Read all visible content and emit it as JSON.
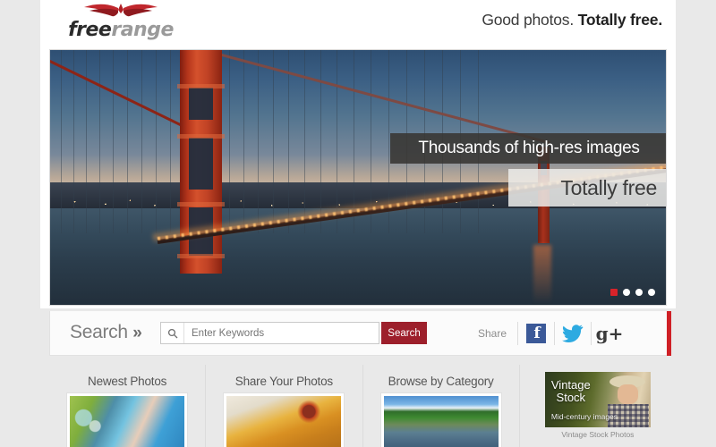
{
  "header": {
    "logo": {
      "part1": "free",
      "part2": "range",
      "icon": "wings-logo-icon"
    },
    "tagline_regular": "Good photos.",
    "tagline_bold": "Totally free."
  },
  "hero": {
    "alt": "golden-gate-bridge-at-dusk",
    "banner_top": "Thousands of high-res images",
    "banner_bottom": "Totally free",
    "dots": [
      {
        "label": "1",
        "active": true
      },
      {
        "label": "2",
        "active": false
      },
      {
        "label": "3",
        "active": false
      },
      {
        "label": "4",
        "active": false
      }
    ]
  },
  "search": {
    "label": "Search",
    "chevron": "»",
    "placeholder": "Enter Keywords",
    "value": "",
    "button_label": "Search",
    "icon": "magnifier-icon"
  },
  "share": {
    "label": "Share",
    "networks": [
      {
        "name": "facebook",
        "glyph": "f"
      },
      {
        "name": "twitter",
        "glyph": "twitter-bird-icon"
      },
      {
        "name": "googleplus",
        "glyph": "g+"
      }
    ]
  },
  "panels": [
    {
      "title": "Newest Photos",
      "thumb": "bubbles-photo"
    },
    {
      "title": "Share Your Photos",
      "thumb": "dragonfly-photo"
    },
    {
      "title": "Browse by Category",
      "thumb": "bluebonnet-field-photo"
    }
  ],
  "ad": {
    "line1": "Vintage",
    "line2": "Stock",
    "subtitle": "Mid-century images",
    "caption": "Vintage Stock Photos"
  },
  "colors": {
    "brand_red": "#9d1f2b",
    "accent_red": "#cf2026",
    "facebook_blue": "#3b5998",
    "twitter_blue": "#2daae1",
    "page_bg": "#e9e9e9"
  }
}
